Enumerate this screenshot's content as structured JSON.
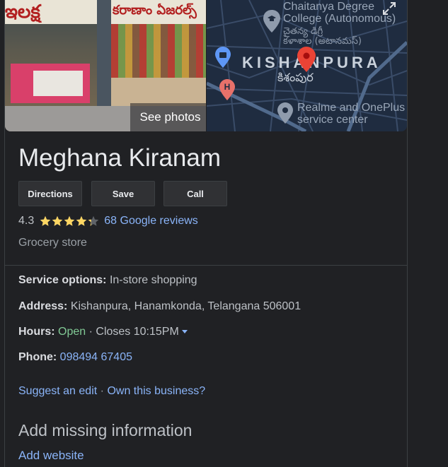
{
  "photos": {
    "see_photos_label": "See photos",
    "sign_text": "ఇలక్ష",
    "sign_text2": "కరాణాం ఏజరల్స్"
  },
  "map": {
    "labels": {
      "college_line1": "Chaitanya Degree",
      "college_line2": "College (Autonomous)",
      "college_tel1": "చైతన్య డిగ్రీ",
      "college_tel2": "కళాశాల (అటానమస్)",
      "area": "KISHANPURA",
      "area_tel": "కిశంపుర",
      "store_line1": "Realme and OnePlus",
      "store_line2": "service center"
    },
    "icons": [
      "school-pin-icon",
      "shopping-pin-icon",
      "hospital-pin-icon",
      "red-location-pin-icon",
      "gray-location-pin-icon",
      "expand-icon"
    ]
  },
  "business": {
    "name": "Meghana Kiranam",
    "buttons": {
      "directions": "Directions",
      "save": "Save",
      "call": "Call"
    },
    "rating": "4.3",
    "rating_value": 4.3,
    "reviews_label": "68 Google reviews",
    "category": "Grocery store"
  },
  "details": {
    "service_label": "Service options:",
    "service_value": "In-store shopping",
    "address_label": "Address:",
    "address_value": "Kishanpura, Hanamkonda, Telangana 506001",
    "hours_label": "Hours:",
    "hours_status": "Open",
    "hours_sep": "·",
    "hours_value": "Closes 10:15PM",
    "phone_label": "Phone:",
    "phone_value": "098494 67405"
  },
  "actions": {
    "suggest_edit": "Suggest an edit",
    "separator": "·",
    "own_business": "Own this business?"
  },
  "missing": {
    "heading": "Add missing information",
    "add_website": "Add website"
  },
  "colors": {
    "background": "#202124",
    "link": "#8ab4f8",
    "open": "#81c995",
    "star": "#fdd663",
    "pin_red": "#ea4335"
  }
}
